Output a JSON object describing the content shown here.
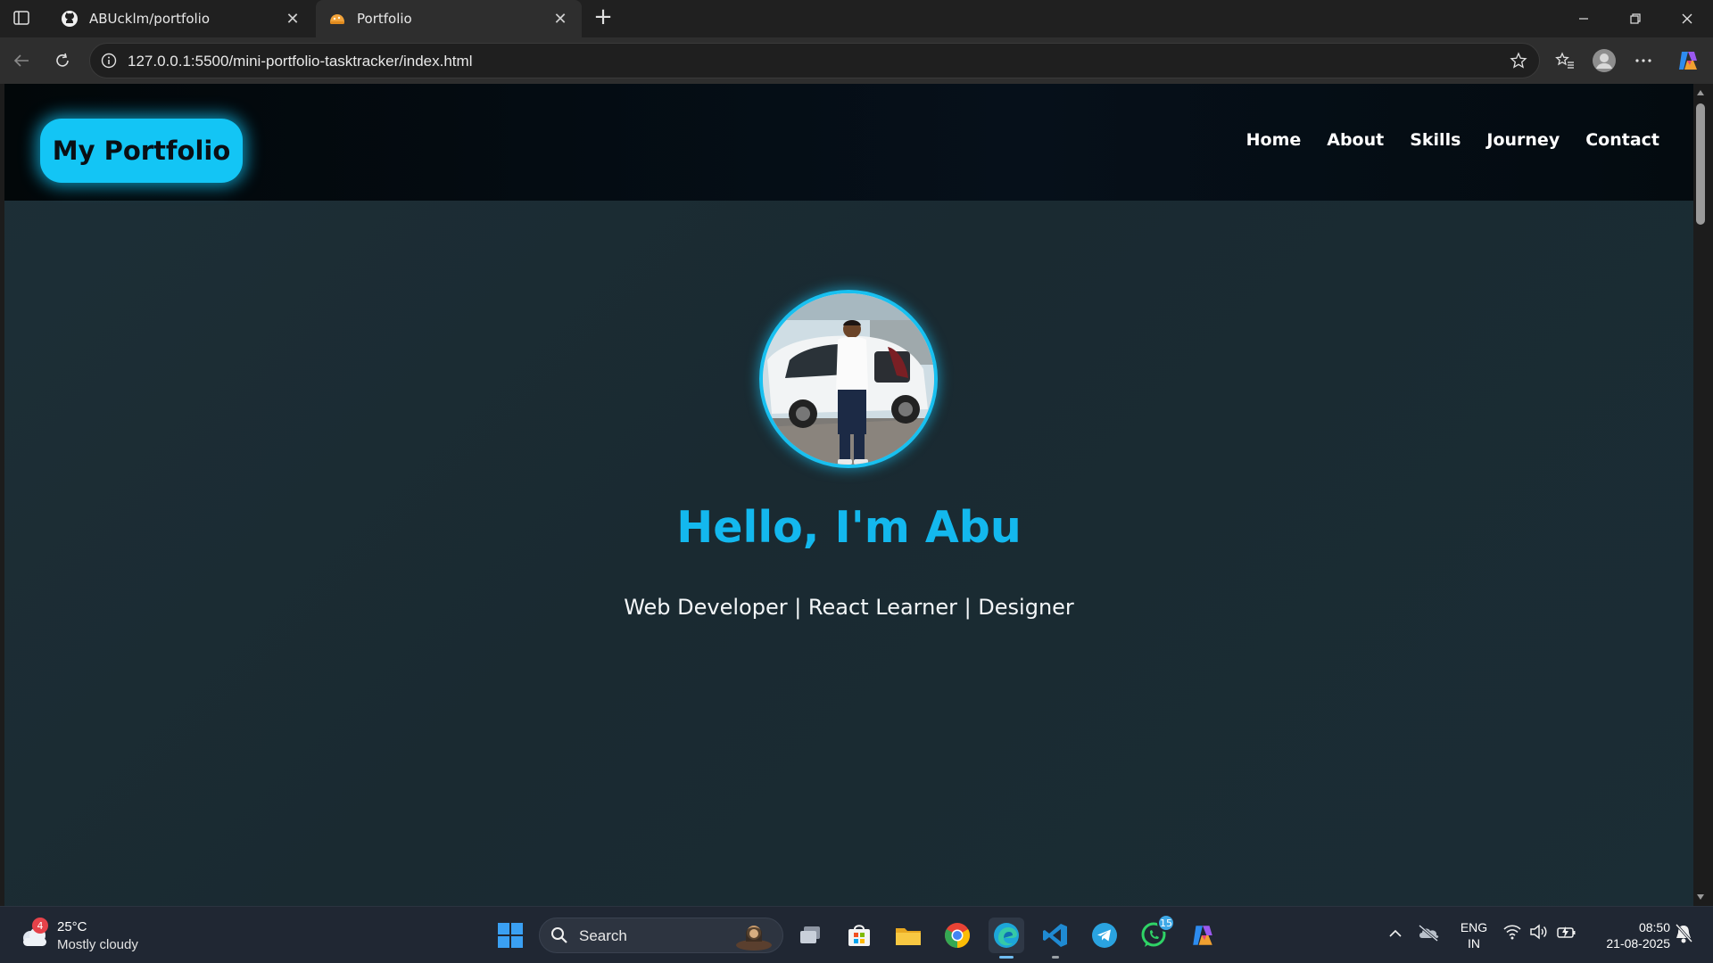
{
  "browser": {
    "tabs": [
      {
        "title": "ABUcklm/portfolio",
        "icon": "github-icon"
      },
      {
        "title": "Portfolio",
        "icon": "portfolio-favicon-icon",
        "active": true
      }
    ],
    "address": "127.0.0.1:5500/mini-portfolio-tasktracker/index.html"
  },
  "site": {
    "logo": "My Portfolio",
    "nav": [
      "Home",
      "About",
      "Skills",
      "Journey",
      "Contact"
    ],
    "hero_title": "Hello, I'm Abu",
    "hero_subtitle": "Web Developer | React Learner | Designer",
    "accent_color": "#13c5f5"
  },
  "taskbar": {
    "weather_badge": "4",
    "temperature": "25°C",
    "condition": "Mostly cloudy",
    "search_label": "Search",
    "whatsapp_badge": "15",
    "lang_top": "ENG",
    "lang_bottom": "IN",
    "time": "08:50",
    "date": "21-08-2025"
  }
}
